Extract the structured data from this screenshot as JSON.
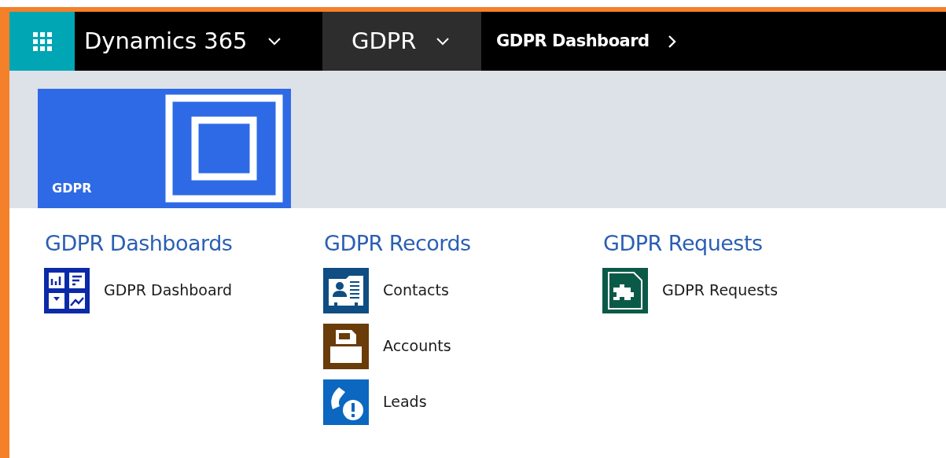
{
  "nav": {
    "app_title": "Dynamics 365",
    "area": "GDPR",
    "breadcrumb": "GDPR Dashboard"
  },
  "tile": {
    "label": "GDPR"
  },
  "sections": [
    {
      "title": "GDPR Dashboards",
      "items": [
        {
          "label": "GDPR Dashboard",
          "kind": "dashboard",
          "color": "#0b2aa8"
        }
      ]
    },
    {
      "title": "GDPR Records",
      "items": [
        {
          "label": "Contacts",
          "kind": "contact",
          "color": "#0f4d82"
        },
        {
          "label": "Accounts",
          "kind": "account",
          "color": "#6a3c0a"
        },
        {
          "label": "Leads",
          "kind": "lead",
          "color": "#0b67c0"
        }
      ]
    },
    {
      "title": "GDPR Requests",
      "items": [
        {
          "label": "GDPR Requests",
          "kind": "request",
          "color": "#0b5a47"
        }
      ]
    }
  ]
}
